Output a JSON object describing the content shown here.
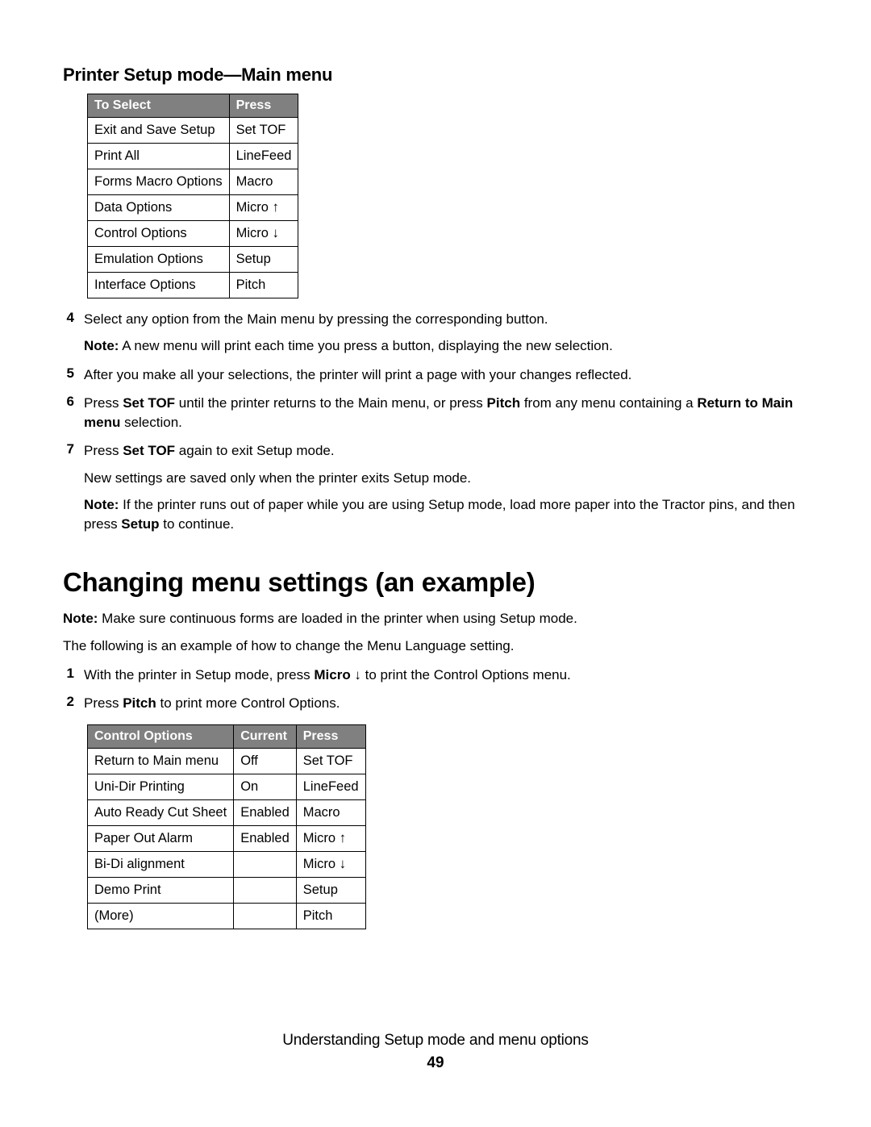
{
  "section1": {
    "title": "Printer Setup mode—Main menu",
    "table": {
      "headers": [
        "To Select",
        "Press"
      ],
      "rows": [
        [
          "Exit and Save Setup",
          "Set TOF"
        ],
        [
          "Print All",
          "LineFeed"
        ],
        [
          "Forms Macro Options",
          "Macro"
        ],
        [
          "Data Options",
          "Micro ↑"
        ],
        [
          "Control Options",
          "Micro ↓"
        ],
        [
          "Emulation Options",
          "Setup"
        ],
        [
          "Interface Options",
          "Pitch"
        ]
      ]
    }
  },
  "steps1": {
    "s4": {
      "num": "4",
      "text": "Select any option from the Main menu by pressing the corresponding button."
    },
    "s4_note_prefix": "Note:",
    "s4_note_body": " A new menu will print each time you press a button, displaying the new selection.",
    "s5": {
      "num": "5",
      "text": "After you make all your selections, the printer will print a page with your changes reflected."
    },
    "s6": {
      "num": "6",
      "p1a": "Press ",
      "p1b": "Set TOF",
      "p1c": " until the printer returns to the Main menu, or press ",
      "p1d": "Pitch",
      "p1e": " from any menu containing a ",
      "p1f": "Return to Main menu",
      "p1g": " selection."
    },
    "s7": {
      "num": "7",
      "p1a": "Press ",
      "p1b": "Set TOF",
      "p1c": " again to exit Setup mode."
    },
    "s7_sub": "New settings are saved only when the printer exits Setup mode.",
    "s7_note_prefix": "Note:",
    "s7_note_a": " If the printer runs out of paper while you are using Setup mode, load more paper into the Tractor pins, and then press ",
    "s7_note_b": "Setup",
    "s7_note_c": " to continue."
  },
  "section2": {
    "heading": "Changing menu settings (an example)",
    "note_prefix": "Note:",
    "note_body": " Make sure continuous forms are loaded in the printer when using Setup mode.",
    "intro": "The following is an example of how to change the Menu Language setting."
  },
  "steps2": {
    "s1": {
      "num": "1",
      "a": "With the printer in Setup mode, press ",
      "b": "Micro",
      "c": " ↓ to print the Control Options menu."
    },
    "s2": {
      "num": "2",
      "a": "Press ",
      "b": "Pitch",
      "c": " to print more Control Options."
    },
    "table": {
      "headers": [
        "Control Options",
        "Current",
        "Press"
      ],
      "rows": [
        [
          "Return to Main menu",
          "Off",
          "Set TOF"
        ],
        [
          "Uni-Dir Printing",
          "On",
          "LineFeed"
        ],
        [
          "Auto Ready Cut Sheet",
          "Enabled",
          "Macro"
        ],
        [
          "Paper Out Alarm",
          "Enabled",
          "Micro ↑"
        ],
        [
          "Bi-Di alignment",
          "",
          "Micro ↓"
        ],
        [
          "Demo Print",
          "",
          "Setup"
        ],
        [
          "(More)",
          "",
          "Pitch"
        ]
      ]
    }
  },
  "footer": {
    "line1": "Understanding Setup mode and menu options",
    "page": "49"
  }
}
